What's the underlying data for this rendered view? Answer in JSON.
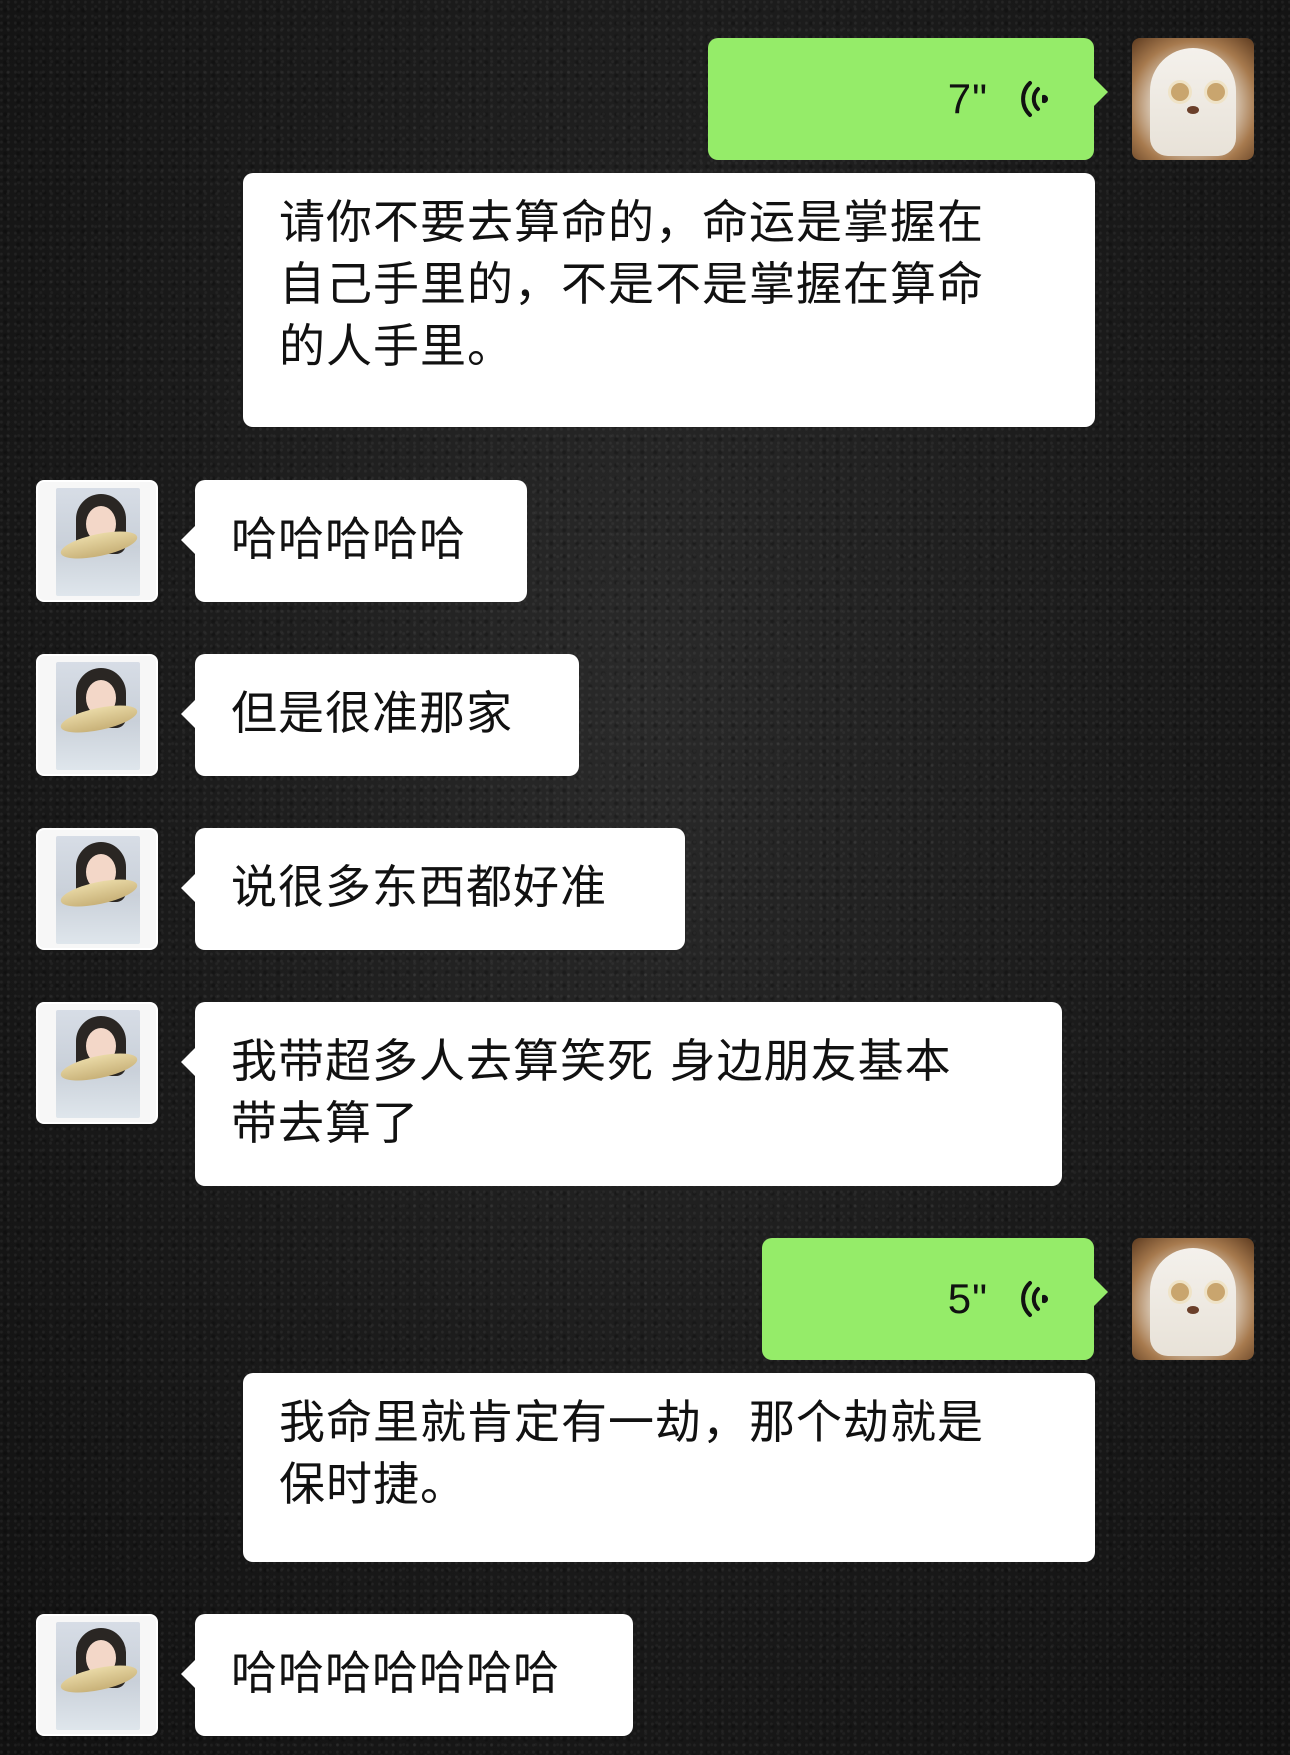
{
  "messages": [
    {
      "sender": "me",
      "type": "voice",
      "duration": "7\""
    },
    {
      "sender": "me",
      "type": "transcript",
      "text": "请你不要去算命的，命运是掌握在\n自己手里的，不是不是掌握在算命\n的人手里。"
    },
    {
      "sender": "friend",
      "type": "text",
      "text": "哈哈哈哈哈"
    },
    {
      "sender": "friend",
      "type": "text",
      "text": "但是很准那家"
    },
    {
      "sender": "friend",
      "type": "text",
      "text": "说很多东西都好准"
    },
    {
      "sender": "friend",
      "type": "text",
      "text": "我带超多人去算笑死 身边朋友基本\n带去算了"
    },
    {
      "sender": "me",
      "type": "voice",
      "duration": "5\""
    },
    {
      "sender": "me",
      "type": "transcript",
      "text": "我命里就肯定有一劫，那个劫就是\n保时捷。"
    },
    {
      "sender": "friend",
      "type": "text",
      "text": "哈哈哈哈哈哈哈"
    }
  ],
  "colors": {
    "my_bubble": "#95ec69",
    "friend_bubble": "#ffffff",
    "transcript_bubble": "#ffffff"
  },
  "icons": {
    "voice": "voice-wave-icon",
    "my_avatar": "ghost-dog-avatar",
    "friend_avatar": "girl-photo-avatar"
  }
}
